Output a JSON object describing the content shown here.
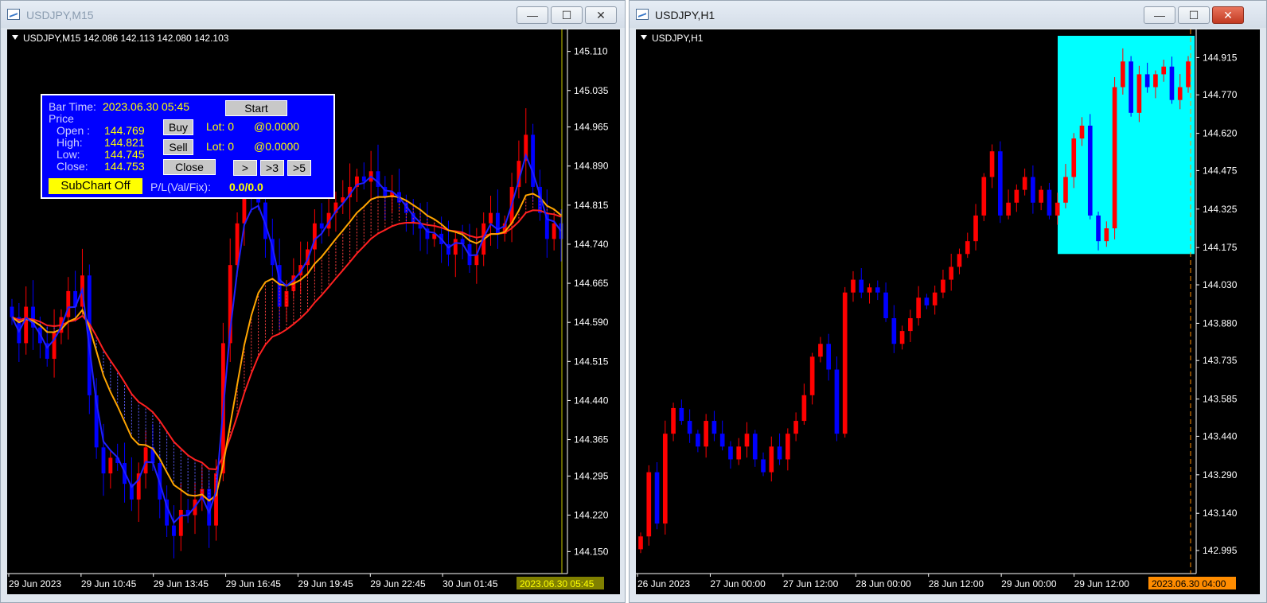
{
  "left_window": {
    "title": "USDJPY,M15",
    "chart_label": "USDJPY,M15  142.086 142.113 142.080 142.103",
    "price_labels": [
      "145.110",
      "145.035",
      "144.965",
      "144.890",
      "144.815",
      "144.740",
      "144.665",
      "144.590",
      "144.515",
      "144.440",
      "144.365",
      "144.295",
      "144.220",
      "144.150"
    ],
    "time_labels": [
      "29 Jun 2023",
      "29 Jun 10:45",
      "29 Jun 13:45",
      "29 Jun 16:45",
      "29 Jun 19:45",
      "29 Jun 22:45",
      "30 Jun 01:45"
    ],
    "current_time": "2023.06.30 05:45"
  },
  "right_window": {
    "title": "USDJPY,H1",
    "chart_label": "USDJPY,H1",
    "price_labels": [
      "144.915",
      "144.770",
      "144.620",
      "144.475",
      "144.325",
      "144.175",
      "144.030",
      "143.880",
      "143.735",
      "143.585",
      "143.440",
      "143.290",
      "143.140",
      "142.995"
    ],
    "time_labels": [
      "26 Jun 2023",
      "27 Jun 00:00",
      "27 Jun 12:00",
      "28 Jun 00:00",
      "28 Jun 12:00",
      "29 Jun 00:00",
      "29 Jun 12:00"
    ],
    "current_time": "2023.06.30 04:00"
  },
  "window_buttons": {
    "minimize": "—",
    "maximize": "☐",
    "close": "✕"
  },
  "panel": {
    "bar_time_label": "Bar Time:",
    "bar_time": "2023.06.30 05:45",
    "start_label": "Start",
    "price_label": "Price",
    "open_label": "Open :",
    "open": "144.769",
    "high_label": "High:",
    "high": "144.821",
    "low_label": "Low:",
    "low": "144.745",
    "close_label": "Close:",
    "close": "144.753",
    "buy_label": "Buy",
    "sell_label": "Sell",
    "close_button": "Close",
    "lot_buy": "Lot: 0",
    "at_buy": "@0.0000",
    "lot_sell": "Lot: 0",
    "at_sell": "@0.0000",
    "step1": ">",
    "step3": ">3",
    "step5": ">5",
    "subchart_label": "SubChart Off",
    "pl_label": "P/L(Val/Fix):",
    "pl_value": "0.0/0.0"
  },
  "colors": {
    "bull": "#ff0000",
    "bear": "#0000ff",
    "background": "#000000",
    "panel": "#0000ff",
    "highlight": "#00ffff",
    "yellow": "#ffff00",
    "orange": "#ffa500"
  },
  "chart_data": [
    {
      "type": "candlestick",
      "symbol": "USDJPY",
      "timeframe": "M15",
      "ylim": [
        144.12,
        145.14
      ],
      "current_price": 144.753,
      "series": [
        {
          "values": [
            144.6,
            144.55,
            144.62,
            144.58,
            144.55,
            144.52,
            144.57,
            144.6,
            144.65,
            144.62,
            144.68,
            144.45,
            144.35,
            144.3,
            144.33,
            144.32,
            144.28,
            144.25,
            144.3,
            144.35,
            144.32,
            144.25,
            144.2,
            144.18,
            144.23,
            144.22,
            144.25,
            144.27,
            144.2,
            144.3,
            144.55,
            144.7,
            144.78,
            144.85,
            144.83,
            144.82,
            144.75,
            144.7,
            144.62,
            144.65,
            144.68,
            144.7,
            144.73,
            144.78,
            144.77,
            144.8,
            144.82,
            144.83,
            144.85,
            144.87,
            144.86,
            144.88,
            144.85,
            144.83,
            144.84,
            144.82,
            144.8,
            144.78,
            144.77,
            144.75,
            144.76,
            144.74,
            144.72,
            144.75,
            144.74,
            144.7,
            144.72,
            144.78,
            144.8,
            144.76,
            144.78,
            144.85,
            144.9,
            144.95,
            144.85,
            144.8,
            144.75,
            144.78,
            144.75
          ]
        }
      ]
    },
    {
      "type": "candlestick",
      "symbol": "USDJPY",
      "timeframe": "H1",
      "ylim": [
        142.93,
        145.0
      ],
      "current_price": 144.78,
      "series": [
        {
          "values": [
            143.05,
            143.3,
            143.1,
            143.45,
            143.55,
            143.5,
            143.45,
            143.4,
            143.5,
            143.45,
            143.4,
            143.35,
            143.4,
            143.45,
            143.35,
            143.3,
            143.4,
            143.35,
            143.45,
            143.5,
            143.6,
            143.75,
            143.8,
            143.7,
            143.45,
            144.0,
            144.05,
            144.0,
            144.02,
            144.0,
            143.9,
            143.8,
            143.85,
            143.9,
            143.98,
            143.95,
            144.0,
            144.05,
            144.1,
            144.15,
            144.2,
            144.3,
            144.45,
            144.55,
            144.3,
            144.35,
            144.4,
            144.45,
            144.35,
            144.4,
            144.3,
            144.35,
            144.45,
            144.6,
            144.65,
            144.3,
            144.2,
            144.25,
            144.8,
            144.9,
            144.7,
            144.85,
            144.8,
            144.85,
            144.88,
            144.75,
            144.8,
            144.9
          ]
        }
      ]
    }
  ]
}
